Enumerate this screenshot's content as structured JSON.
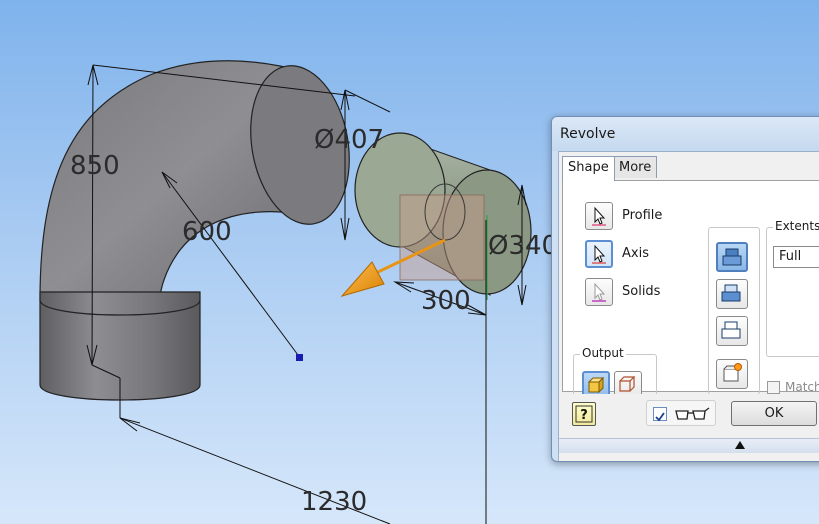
{
  "viewport": {
    "dimensions": {
      "elbow_height": "850",
      "bend_radius": "600",
      "elbow_diameter": "Ø407",
      "cylinder_diameter": "Ø340",
      "cylinder_length": "300",
      "overall_length": "1230"
    }
  },
  "dialog": {
    "title": "Revolve",
    "tabs": [
      "Shape",
      "More"
    ],
    "selectors": {
      "profile": "Profile",
      "axis": "Axis",
      "solids": "Solids"
    },
    "output_label": "Output",
    "extents_label": "Extents",
    "extents_value": "Full",
    "match_label": "Match s",
    "ok_label": "OK"
  },
  "icons": {
    "help": "help-icon",
    "preview": "glasses-icon",
    "expand": "expand-arrow-icon"
  }
}
